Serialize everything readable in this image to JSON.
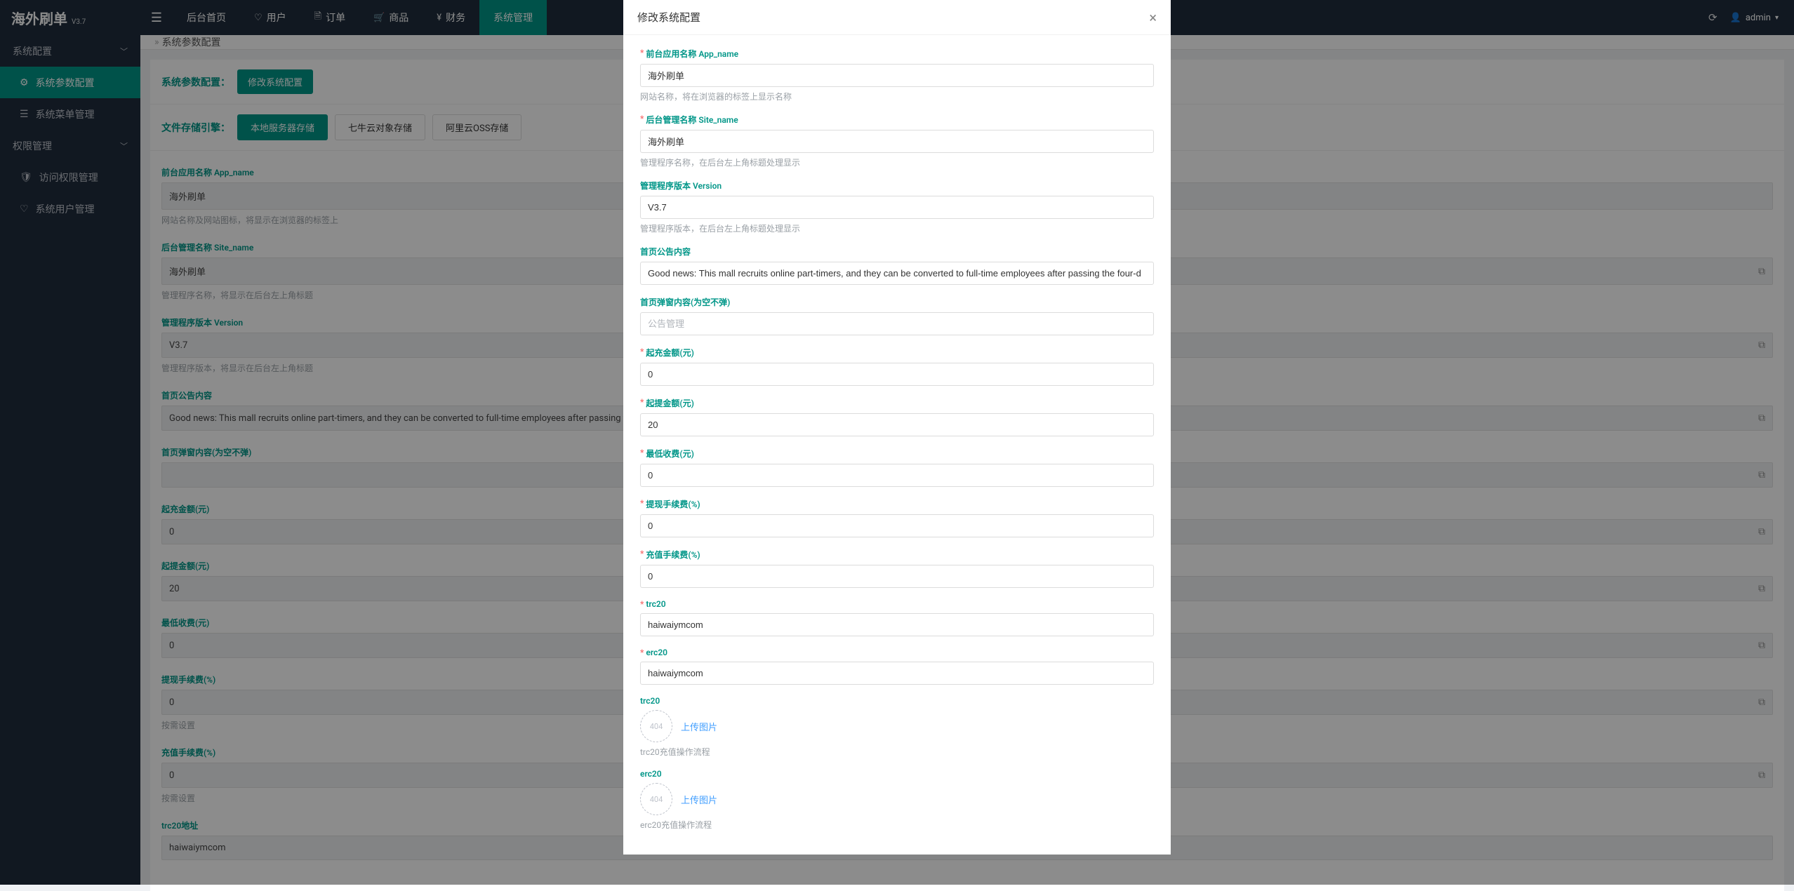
{
  "header": {
    "logo_main": "海外刷单",
    "logo_ver": "V3.7",
    "nav": {
      "home": "后台首页",
      "user": "用户",
      "order": "订单",
      "goods": "商品",
      "finance": "财务",
      "system": "系统管理"
    },
    "user": "admin"
  },
  "sidebar": {
    "group_system": "系统配置",
    "leaf_param": "系统参数配置",
    "leaf_menu": "系统菜单管理",
    "group_perm": "权限管理",
    "leaf_access": "访问权限管理",
    "leaf_user": "系统用户管理"
  },
  "crumb": {
    "page": "系统参数配置"
  },
  "panel": {
    "title": "系统参数配置：",
    "edit_btn": "修改系统配置",
    "storage_title": "文件存储引擎：",
    "tabs": {
      "local": "本地服务器存储",
      "qiniu": "七牛云对象存储",
      "ali": "阿里云OSS存储"
    }
  },
  "form": {
    "app_name": {
      "label": "前台应用名称 App_name",
      "value": "海外刷单",
      "hint": "网站名称及网站图标，将显示在浏览器的标签上"
    },
    "site_name": {
      "label": "后台管理名称 Site_name",
      "value": "海外刷单",
      "hint": "管理程序名称，将显示在后台左上角标题"
    },
    "version": {
      "label": "管理程序版本 Version",
      "value": "V3.7",
      "hint": "管理程序版本，将显示在后台左上角标题"
    },
    "notice": {
      "label": "首页公告内容",
      "value": "Good news: This mall recruits online part-timers, and they can be converted to full-time employees after passing the four-d"
    },
    "popup": {
      "label": "首页弹窗内容(为空不弹)",
      "value": ""
    },
    "min_recharge": {
      "label": "起充金额(元)",
      "value": "0"
    },
    "min_withdraw": {
      "label": "起提金额(元)",
      "value": "20"
    },
    "min_fee": {
      "label": "最低收费(元)",
      "value": "0"
    },
    "withdraw_pct": {
      "label": "提现手续费(%)",
      "value": "0",
      "hint": "按需设置"
    },
    "recharge_pct": {
      "label": "充值手续费(%)",
      "value": "0",
      "hint": "按需设置"
    },
    "trc20_addr": {
      "label": "trc20地址",
      "value": "haiwaiymcom"
    }
  },
  "dialog": {
    "title": "修改系统配置",
    "app_name": {
      "label": "前台应用名称 App_name",
      "value": "海外刷单",
      "hint": "网站名称，将在浏览器的标签上显示名称"
    },
    "site_name": {
      "label": "后台管理名称 Site_name",
      "value": "海外刷单",
      "hint": "管理程序名称，在后台左上角标题处理显示"
    },
    "version": {
      "label": "管理程序版本 Version",
      "value": "V3.7",
      "hint": "管理程序版本，在后台左上角标题处理显示"
    },
    "notice": {
      "label": "首页公告内容",
      "value": "Good news: This mall recruits online part-timers, and they can be converted to full-time employees after passing the four-d"
    },
    "popup": {
      "label": "首页弹窗内容(为空不弹)",
      "placeholder": "公告管理"
    },
    "min_recharge": {
      "label": "起充金额(元)",
      "value": "0"
    },
    "min_withdraw": {
      "label": "起提金额(元)",
      "value": "20"
    },
    "min_fee": {
      "label": "最低收费(元)",
      "value": "0"
    },
    "withdraw_pct": {
      "label": "提现手续费(%)",
      "value": "0"
    },
    "recharge_pct": {
      "label": "充值手续费(%)",
      "value": "0"
    },
    "trc20": {
      "label": "trc20",
      "value": "haiwaiymcom"
    },
    "erc20": {
      "label": "erc20",
      "value": "haiwaiymcom"
    },
    "trc20_img": {
      "label": "trc20",
      "upload": "上传图片",
      "hint": "trc20充值操作流程",
      "placeholder": "404"
    },
    "erc20_img": {
      "label": "erc20",
      "upload": "上传图片",
      "hint": "erc20充值操作流程",
      "placeholder": "404"
    }
  }
}
